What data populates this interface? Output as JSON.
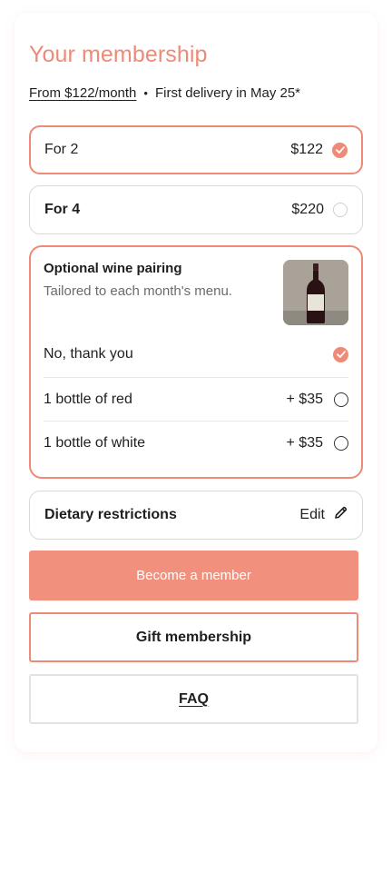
{
  "header": {
    "title": "Your membership",
    "price_from": "From $122/month",
    "separator": "•",
    "delivery": "First delivery in May 25*"
  },
  "plans": [
    {
      "label": "For 2",
      "price": "$122",
      "selected": true
    },
    {
      "label": "For 4",
      "price": "$220",
      "selected": false
    }
  ],
  "wine_pairing": {
    "title": "Optional wine pairing",
    "subtitle": "Tailored to each month's menu.",
    "options": [
      {
        "label": "No, thank you",
        "price": "",
        "selected": true
      },
      {
        "label": "1 bottle of red",
        "price": "+ $35",
        "selected": false
      },
      {
        "label": "1 bottle of white",
        "price": "+ $35",
        "selected": false
      }
    ]
  },
  "dietary": {
    "label": "Dietary restrictions",
    "action": "Edit"
  },
  "buttons": {
    "primary": "Become a member",
    "gift": "Gift membership",
    "faq": "FAQ"
  },
  "colors": {
    "accent": "#ee8a78",
    "primary_button": "#f0907d"
  },
  "icons": [
    "check-icon",
    "pencil-icon",
    "wine-bottle-image"
  ]
}
